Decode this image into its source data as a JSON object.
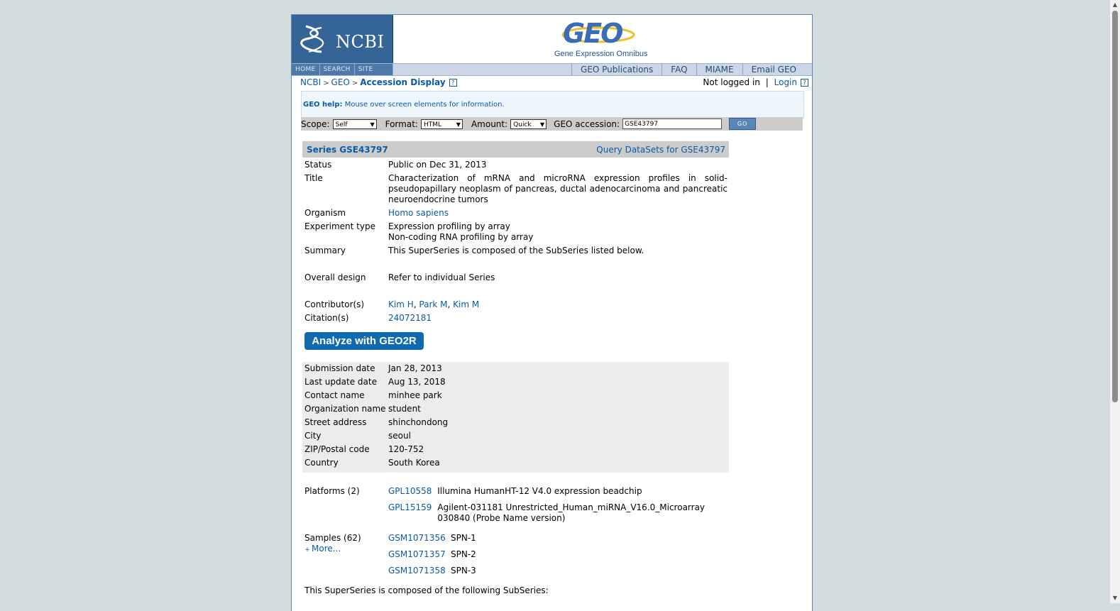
{
  "header": {
    "ncbi_logo_text": "NCBI",
    "geo_logo_text": "GEO",
    "geo_tagline": "Gene Expression Omnibus",
    "nav_left": [
      "HOME",
      "SEARCH",
      "SITE MAP"
    ],
    "nav_right": [
      "GEO Publications",
      "FAQ",
      "MIAME",
      "Email GEO"
    ]
  },
  "breadcrumb": {
    "items": [
      "NCBI",
      "GEO"
    ],
    "separator": ">",
    "current": "Accession Display",
    "help_glyph": "?"
  },
  "auth": {
    "status": "Not logged in",
    "separator": "|",
    "login_label": "Login",
    "help_glyph": "?"
  },
  "help_box": {
    "label": "GEO help:",
    "text": "Mouse over screen elements for information."
  },
  "query_bar": {
    "scope_label": "Scope:",
    "scope_value": "Self",
    "format_label": "Format:",
    "format_value": "HTML",
    "amount_label": "Amount:",
    "amount_value": "Quick",
    "accession_label": "GEO accession:",
    "accession_value": "GSE43797",
    "go_label": "GO",
    "arrow_glyph": "▼"
  },
  "series": {
    "id_label": "Series GSE43797",
    "query_datasets_label": "Query DataSets for GSE43797",
    "fields": {
      "status": {
        "key": "Status",
        "value": "Public on Dec 31, 2013"
      },
      "title": {
        "key": "Title",
        "value": "Characterization of mRNA and microRNA expression profiles in solid-pseudopapillary neoplasm of pancreas, ductal adenocarcinoma and pancreatic neuroendocrine tumors"
      },
      "organism": {
        "key": "Organism",
        "value": "Homo sapiens"
      },
      "experiment_type": {
        "key": "Experiment type",
        "values": [
          "Expression profiling by array",
          "Non-coding RNA profiling by array"
        ]
      },
      "summary": {
        "key": "Summary",
        "value": "This SuperSeries is composed of the SubSeries listed below."
      },
      "overall_design": {
        "key": "Overall design",
        "value": "Refer to individual Series"
      },
      "contributors": {
        "key": "Contributor(s)",
        "names": [
          "Kim H",
          "Park M",
          "Kim M"
        ],
        "separator": ","
      },
      "citations": {
        "key": "Citation(s)",
        "value": "24072181"
      }
    },
    "analyze_button": "Analyze with GEO2R",
    "submission": [
      {
        "key": "Submission date",
        "value": "Jan 28, 2013"
      },
      {
        "key": "Last update date",
        "value": "Aug 13, 2018"
      },
      {
        "key": "Contact name",
        "value": "minhee park"
      },
      {
        "key": "Organization name",
        "value": "student"
      },
      {
        "key": "Street address",
        "value": "shinchondong"
      },
      {
        "key": "City",
        "value": "seoul"
      },
      {
        "key": "ZIP/Postal code",
        "value": "120-752"
      },
      {
        "key": "Country",
        "value": "South Korea"
      }
    ],
    "platforms": {
      "key": "Platforms (2)",
      "items": [
        {
          "id": "GPL10558",
          "desc": "Illumina HumanHT-12 V4.0 expression beadchip"
        },
        {
          "id": "GPL15159",
          "desc": "Agilent-031181 Unrestricted_Human_miRNA_V16.0_Microarray 030840 (Probe Name version)"
        }
      ]
    },
    "samples": {
      "key": "Samples (62)",
      "more_label": "More...",
      "more_glyph": "+",
      "items": [
        {
          "id": "GSM1071356",
          "desc": "SPN-1"
        },
        {
          "id": "GSM1071357",
          "desc": "SPN-2"
        },
        {
          "id": "GSM1071358",
          "desc": "SPN-3"
        }
      ]
    },
    "subseries_intro": "This SuperSeries is composed of the following SubSeries:"
  },
  "scrollbar": {
    "up_glyph": "▲",
    "down_glyph": "▼"
  }
}
